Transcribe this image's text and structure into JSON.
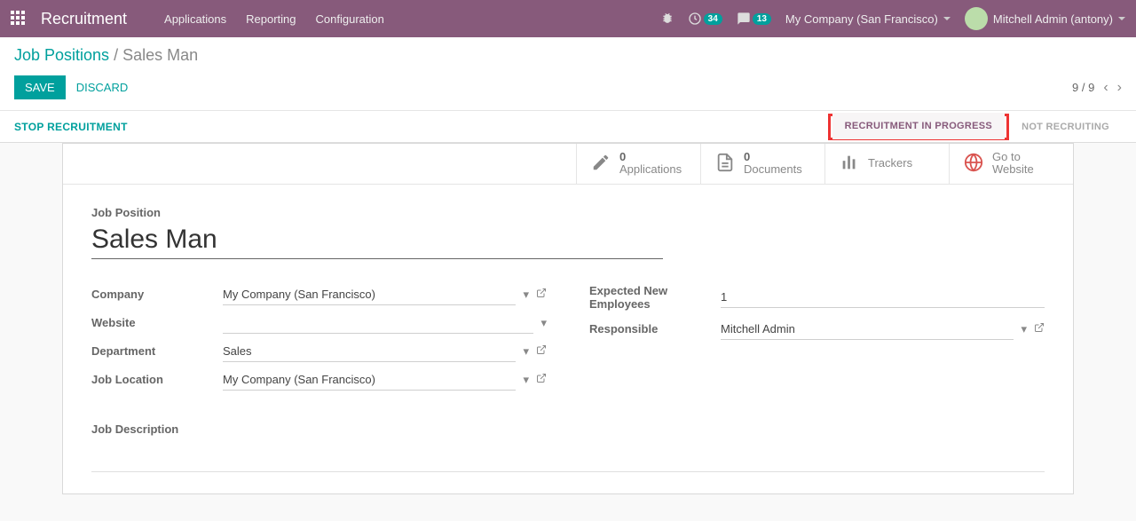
{
  "topbar": {
    "title": "Recruitment",
    "menu": [
      "Applications",
      "Reporting",
      "Configuration"
    ],
    "debug_badge": "34",
    "messages_badge": "13",
    "company": "My Company (San Francisco)",
    "user": "Mitchell Admin (antony)"
  },
  "breadcrumb": {
    "root": "Job Positions",
    "sep": " / ",
    "current": "Sales Man"
  },
  "actions": {
    "save": "SAVE",
    "discard": "DISCARD",
    "pager": "9 / 9"
  },
  "statusbar": {
    "left_button": "STOP RECRUITMENT",
    "active": "RECRUITMENT IN PROGRESS",
    "inactive": "NOT RECRUITING"
  },
  "statbuttons": {
    "applications": {
      "count": "0",
      "label": "Applications"
    },
    "documents": {
      "count": "0",
      "label": "Documents"
    },
    "trackers": {
      "label": "Trackers"
    },
    "website": {
      "line1": "Go to",
      "line2": "Website"
    }
  },
  "form": {
    "title_label": "Job Position",
    "title_value": "Sales Man",
    "labels": {
      "company": "Company",
      "website": "Website",
      "department": "Department",
      "job_location": "Job Location",
      "expected": "Expected New Employees",
      "responsible": "Responsible",
      "job_description": "Job Description"
    },
    "values": {
      "company": "My Company (San Francisco)",
      "website": "",
      "department": "Sales",
      "job_location": "My Company (San Francisco)",
      "expected": "1",
      "responsible": "Mitchell Admin"
    }
  }
}
